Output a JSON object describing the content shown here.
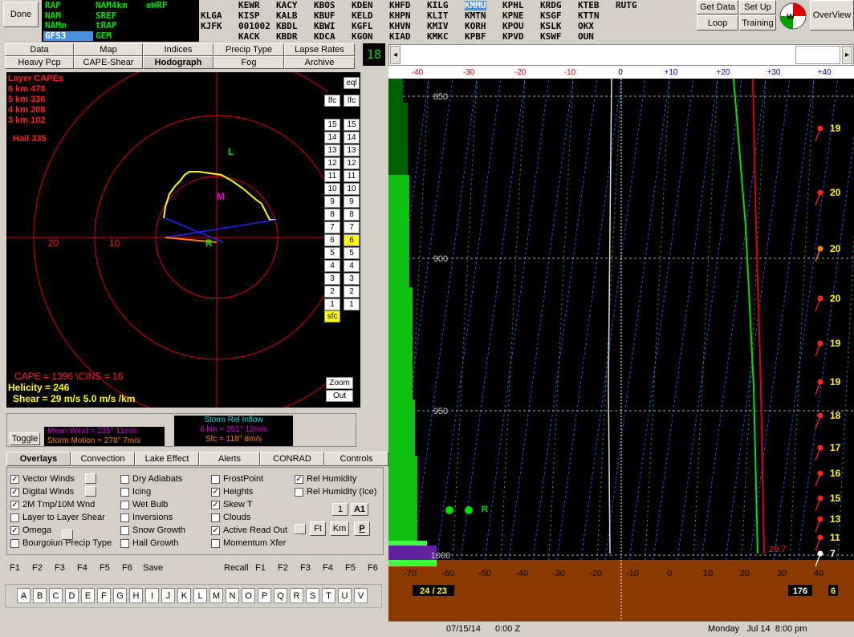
{
  "done_label": "Done",
  "models": [
    {
      "label": "RAP",
      "selected": false
    },
    {
      "label": "NAM",
      "selected": false
    },
    {
      "label": "NAMm",
      "selected": false
    },
    {
      "label": "GFS3",
      "selected": true
    },
    {
      "label": "NAM4km",
      "selected": false
    },
    {
      "label": "SREF",
      "selected": false
    },
    {
      "label": "tRAP",
      "selected": false
    },
    {
      "label": "GEM",
      "selected": false
    },
    {
      "label": "eWRF",
      "selected": false
    }
  ],
  "stations": [
    [
      "",
      "KLGA",
      "KJFK"
    ],
    [
      "KEWR",
      "KISP",
      "001002",
      "KACK"
    ],
    [
      "KACY",
      "KALB",
      "KBDL",
      "KBDR"
    ],
    [
      "KBOS",
      "KBUF",
      "KBWI",
      "KDCA"
    ],
    [
      "KDEN",
      "KELD",
      "KGFL",
      "KGON"
    ],
    [
      "KHFD",
      "KHPN",
      "KHVN",
      "KIAD"
    ],
    [
      "KILG",
      "KLIT",
      "KMIV",
      "KMKC"
    ],
    [
      "KMMU",
      "KMTN",
      "KORH",
      "KPBF"
    ],
    [
      "KPHL",
      "KPNE",
      "KPOU",
      "KPVD"
    ],
    [
      "KRDG",
      "KSGF",
      "KSLK",
      "KSWF"
    ],
    [
      "KTEB",
      "KTTN",
      "OKX",
      "OUN"
    ],
    [
      "RUTG"
    ]
  ],
  "selected_station": "KMMU",
  "top_right": {
    "get_data": "Get Data",
    "set_up": "Set Up",
    "loop": "Loop",
    "training": "Training",
    "overview": "OverView"
  },
  "view_tabs_row1": [
    "Data",
    "Map",
    "Indices",
    "Precip Type",
    "Lapse Rates"
  ],
  "view_tabs_row2": [
    "Heavy Pcp",
    "CAPE-Shear",
    "Hodograph",
    "Fog",
    "Archive"
  ],
  "selected_view": "Hodograph",
  "forecast_hour": "18",
  "hodograph": {
    "layer_capes_title": "Layer CAPEs",
    "layer_capes": [
      "6 km  478",
      "5 km  336",
      "4 km  208",
      "3 km  102"
    ],
    "hail": "Hail  335",
    "ring_labels": [
      "20",
      "10"
    ],
    "marker_L": "L",
    "marker_M": "M",
    "marker_R": "R",
    "cape_line": "CAPE = 1396 \\CINS =  16",
    "helicity_line": "Helicity =  246",
    "shear_line": "Shear =  29 m/s    5.0 m/s /km",
    "eql": "eql",
    "lfc": "lfc",
    "levels": [
      "15",
      "14",
      "13",
      "12",
      "11",
      "10",
      "9",
      "8",
      "7",
      "6",
      "5",
      "4",
      "3",
      "2",
      "1"
    ],
    "highlight_level": "6",
    "sfc": "sfc",
    "zoom": "Zoom",
    "out": "Out"
  },
  "wind_info": {
    "toggle": "Toggle",
    "mean_wind": "Mean Wind = 235°  11m/s",
    "storm_motion": "Storm Motion = 278°  7m/s",
    "sri_title": "Storm Rel Inflow",
    "sri_6km": "6 km = 251°  12m/s",
    "sri_sfc": "Sfc = 118°  8m/s"
  },
  "overlay_tabs": [
    "Overlays",
    "Convection",
    "Lake Effect",
    "Alerts",
    "CONRAD",
    "Controls"
  ],
  "selected_overlay_tab": "Overlays",
  "checkboxes": [
    {
      "label": "Vector Winds",
      "checked": true
    },
    {
      "label": "Digital Winds",
      "checked": true
    },
    {
      "label": "2M Tmp/10M Wnd",
      "checked": true
    },
    {
      "label": "Layer to Layer Shear",
      "checked": false
    },
    {
      "label": "Omega",
      "checked": true
    },
    {
      "label": "Bourgoiun Precip Type",
      "checked": false
    },
    {
      "label": "Dry Adiabats",
      "checked": false
    },
    {
      "label": "Icing",
      "checked": false
    },
    {
      "label": "Wet Bulb",
      "checked": false
    },
    {
      "label": "Inversions",
      "checked": false
    },
    {
      "label": "Snow Growth",
      "checked": false
    },
    {
      "label": "Hail Growth",
      "checked": false
    },
    {
      "label": "FrostPoint",
      "checked": false
    },
    {
      "label": "Heights",
      "checked": true
    },
    {
      "label": "Skew T",
      "checked": true
    },
    {
      "label": "Clouds",
      "checked": false
    },
    {
      "label": "Active Read Out",
      "checked": true
    },
    {
      "label": "Momentum Xfer",
      "checked": false
    },
    {
      "label": "Rel Humidity",
      "checked": true
    },
    {
      "label": "Rel Humidity (Ice)",
      "checked": false
    }
  ],
  "small_buttons": {
    "one": "1",
    "a1": "A1",
    "ft": "Ft",
    "km": "Km",
    "p": "P"
  },
  "fkeys_left": [
    "F1",
    "F2",
    "F3",
    "F4",
    "F5",
    "F6"
  ],
  "save": "Save",
  "recall": "Recall",
  "fkeys_right": [
    "F1",
    "F2",
    "F3",
    "F4",
    "F5",
    "F6"
  ],
  "letters": [
    "A",
    "B",
    "C",
    "D",
    "E",
    "F",
    "G",
    "H",
    "I",
    "J",
    "K",
    "L",
    "M",
    "N",
    "O",
    "P",
    "Q",
    "R",
    "S",
    "T",
    "U",
    "V"
  ],
  "sounding": {
    "top_temps": [
      "-40",
      "-30",
      "-20",
      "-10",
      "0",
      "+10",
      "+20",
      "+30",
      "+40"
    ],
    "bottom_temps": [
      "-70",
      "-60",
      "-50",
      "-40",
      "-30",
      "-20",
      "-10",
      "0",
      "10",
      "20",
      "30",
      "40"
    ],
    "pressure_labels": [
      "850",
      "900",
      "950",
      "1000"
    ],
    "wind_speeds": [
      "19",
      "20",
      "20",
      "20",
      "19",
      "19",
      "18",
      "17",
      "16",
      "15",
      "13",
      "11",
      "7"
    ],
    "surface_temp": "29.7",
    "left_readout": "24 / 23",
    "right_readout": "176",
    "right_readout2": "6",
    "marker_R": "R"
  },
  "status": {
    "date": "07/15/14",
    "zulu": "0:00 Z",
    "local": "Monday   Jul 14  8:00 pm"
  }
}
